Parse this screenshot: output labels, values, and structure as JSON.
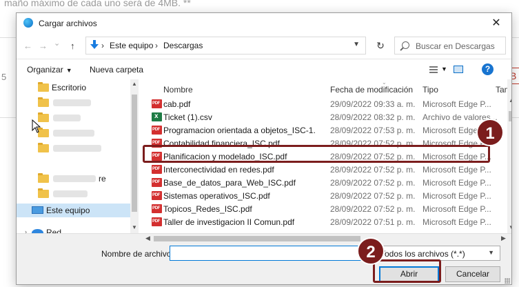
{
  "background": {
    "top_text": "maño máximo de cada uno será de 4MB. **",
    "left_letter": "5",
    "right_letter": "B"
  },
  "dialog": {
    "title": "Cargar archivos",
    "close_glyph": "✕",
    "nav": {
      "back": "←",
      "forward": "→",
      "recent": "⌄",
      "up": "↑"
    },
    "breadcrumb": [
      "Este equipo",
      "Descargas"
    ],
    "breadcrumb_sep": "›",
    "refresh_glyph": "↻",
    "search_placeholder": "Buscar en Descargas",
    "toolbar": {
      "organize": "Organizar",
      "new_folder": "Nueva carpeta",
      "help": "?"
    },
    "nav_pane": {
      "items": [
        {
          "label": "Escritorio",
          "type": "folder"
        },
        {
          "label": "",
          "type": "folder"
        },
        {
          "label": "",
          "type": "folder"
        },
        {
          "label": "",
          "type": "folder"
        },
        {
          "label": "",
          "type": "folder"
        },
        {
          "label": "re",
          "type": "folder"
        },
        {
          "label": "",
          "type": "folder"
        },
        {
          "label": "Este equipo",
          "type": "pc"
        },
        {
          "label": "Red",
          "type": "network"
        }
      ]
    },
    "columns": {
      "name": "Nombre",
      "date": "Fecha de modificación",
      "type": "Tipo",
      "size": "Tamaño"
    },
    "files": [
      {
        "name": "cab.pdf",
        "date": "29/09/2022 09:33 a. m.",
        "type": "Microsoft Edge P...",
        "icon": "pdf"
      },
      {
        "name": "Ticket (1).csv",
        "date": "28/09/2022 08:32 p. m.",
        "type": "Archivo de valores...",
        "icon": "csv"
      },
      {
        "name": "Programacion orientada a objetos_ISC-1...",
        "date": "28/09/2022 07:53 p. m.",
        "type": "Microsoft Edge P...",
        "icon": "pdf"
      },
      {
        "name": "Contabilidad financiera_ISC.pdf",
        "date": "28/09/2022 07:52 p. m.",
        "type": "Microsoft Edge P...",
        "icon": "pdf"
      },
      {
        "name": "Planificacion y modelado_ISC.pdf",
        "date": "28/09/2022 07:52 p. m.",
        "type": "Microsoft Edge P...",
        "icon": "pdf"
      },
      {
        "name": "Interconectividad en redes.pdf",
        "date": "28/09/2022 07:52 p. m.",
        "type": "Microsoft Edge P...",
        "icon": "pdf"
      },
      {
        "name": "Base_de_datos_para_Web_ISC.pdf",
        "date": "28/09/2022 07:52 p. m.",
        "type": "Microsoft Edge P...",
        "icon": "pdf"
      },
      {
        "name": "Sistemas operativos_ISC.pdf",
        "date": "28/09/2022 07:52 p. m.",
        "type": "Microsoft Edge P...",
        "icon": "pdf"
      },
      {
        "name": "Topicos_Redes_ISC.pdf",
        "date": "28/09/2022 07:52 p. m.",
        "type": "Microsoft Edge P...",
        "icon": "pdf"
      },
      {
        "name": "Taller de investigacion II Comun.pdf",
        "date": "28/09/2022 07:51 p. m.",
        "type": "Microsoft Edge P...",
        "icon": "pdf"
      }
    ],
    "filename_label": "Nombre de archivo:",
    "filename_value": "",
    "filter_value": "Todos los archivos (*.*)",
    "open_label": "Abrir",
    "cancel_label": "Cancelar"
  },
  "annotations": {
    "badge_1": "1",
    "badge_2": "2",
    "color": "#7b1d1d"
  }
}
